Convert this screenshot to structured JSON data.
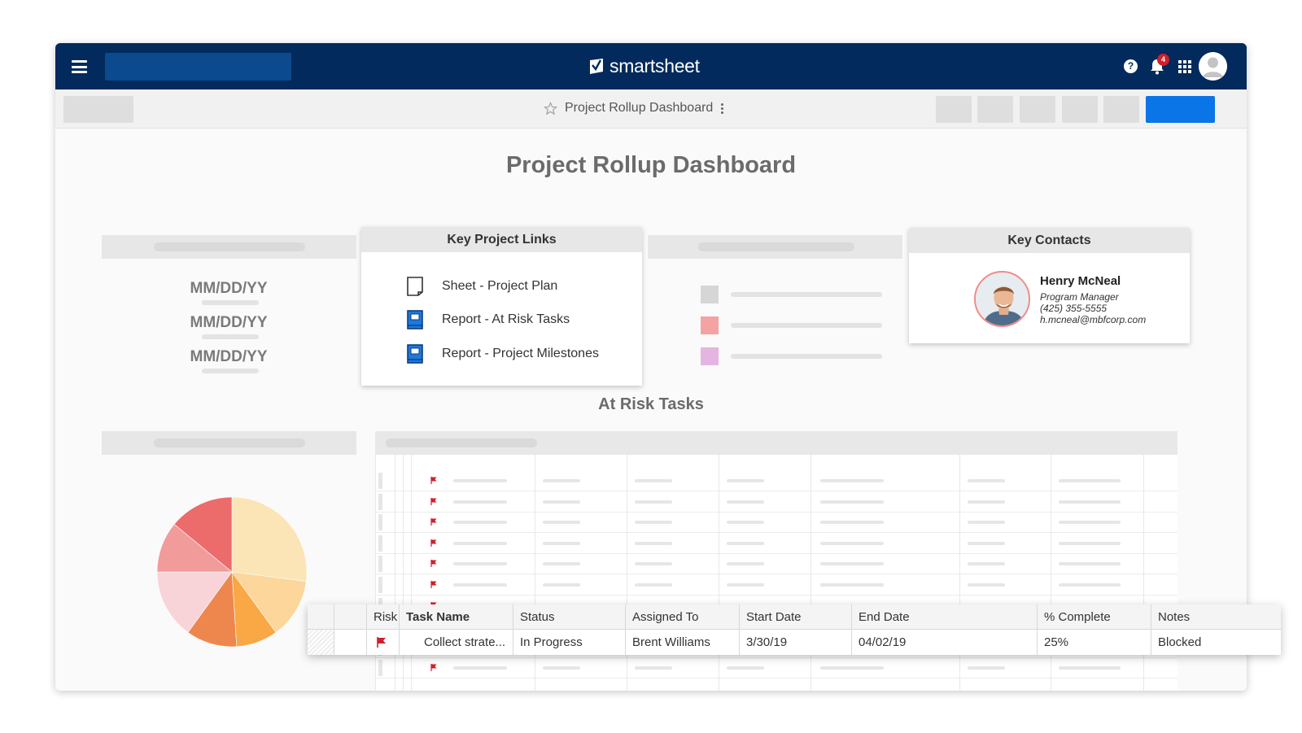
{
  "app": {
    "brand": "smartsheet",
    "notification_count": "4",
    "help_glyph": "?",
    "accent_color": "#0a75e6",
    "topbar_color": "#022a5c"
  },
  "sheet": {
    "title": "Project Rollup Dashboard"
  },
  "dashboard": {
    "title": "Project Rollup Dashboard",
    "dates": [
      "MM/DD/YY",
      "MM/DD/YY",
      "MM/DD/YY"
    ],
    "key_links": {
      "header": "Key Project Links",
      "items": [
        {
          "label": "Sheet - Project Plan",
          "icon": "sheet-icon"
        },
        {
          "label": "Report - At Risk Tasks",
          "icon": "report-icon"
        },
        {
          "label": "Report - Project Milestones",
          "icon": "report-icon"
        }
      ]
    },
    "legend_colors": [
      "#d6d6d6",
      "#f4a3a3",
      "#e4b5e0"
    ],
    "key_contacts": {
      "header": "Key Contacts",
      "name": "Henry McNeal",
      "role": "Program Manager",
      "phone": "(425) 355-5555",
      "email": "h.mcneal@mbfcorp.com"
    },
    "at_risk_title": "At Risk Tasks"
  },
  "task_row": {
    "columns": [
      "Risk",
      "Task Name",
      "Status",
      "Assigned To",
      "Start Date",
      "End Date",
      "% Complete",
      "Notes"
    ],
    "values": {
      "task_name": "Collect strate...",
      "status": "In Progress",
      "assigned_to": "Brent Williams",
      "start_date": "3/30/19",
      "end_date": "04/02/19",
      "percent_complete": "25%",
      "notes": "Blocked"
    },
    "risk_flag_color": "#d01f2b"
  },
  "chart_data": {
    "type": "pie",
    "values": [
      27,
      13,
      9,
      11,
      15,
      11,
      14
    ],
    "colors": [
      "#fbe4b6",
      "#fcd69a",
      "#f9a845",
      "#ee874d",
      "#f8d4d8",
      "#f19b9b",
      "#ec6b6b"
    ]
  }
}
